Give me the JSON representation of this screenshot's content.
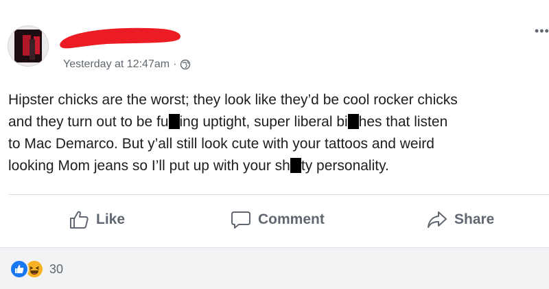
{
  "post": {
    "author": {
      "avatar": "profile-photo",
      "name_redacted": true
    },
    "timestamp": "Yesterday at 12:47am",
    "separator": "·",
    "privacy_icon": "globe-icon",
    "menu_icon": "more-options-icon",
    "text_lines": [
      [
        "Hipster chicks are the worst; they look like they’d be cool rocker chicks"
      ],
      [
        "and they turn out to be fu",
        "ing uptight, super liberal bi",
        "hes that listen"
      ],
      [
        "to Mac Demarco. But y’all still look cute with your tattoos and weird"
      ],
      [
        "looking Mom jeans so I’ll put up with your sh",
        "ty personality."
      ]
    ]
  },
  "actions": {
    "like_label": "Like",
    "comment_label": "Comment",
    "share_label": "Share"
  },
  "reactions": {
    "icons": [
      "like-reaction-icon",
      "haha-reaction-icon"
    ],
    "count": "30"
  },
  "colors": {
    "text": "#1c1e21",
    "muted": "#606770",
    "like_blue": "#1877f2",
    "haha_yellow": "#f7b125",
    "redaction_red": "#ec1c24"
  }
}
